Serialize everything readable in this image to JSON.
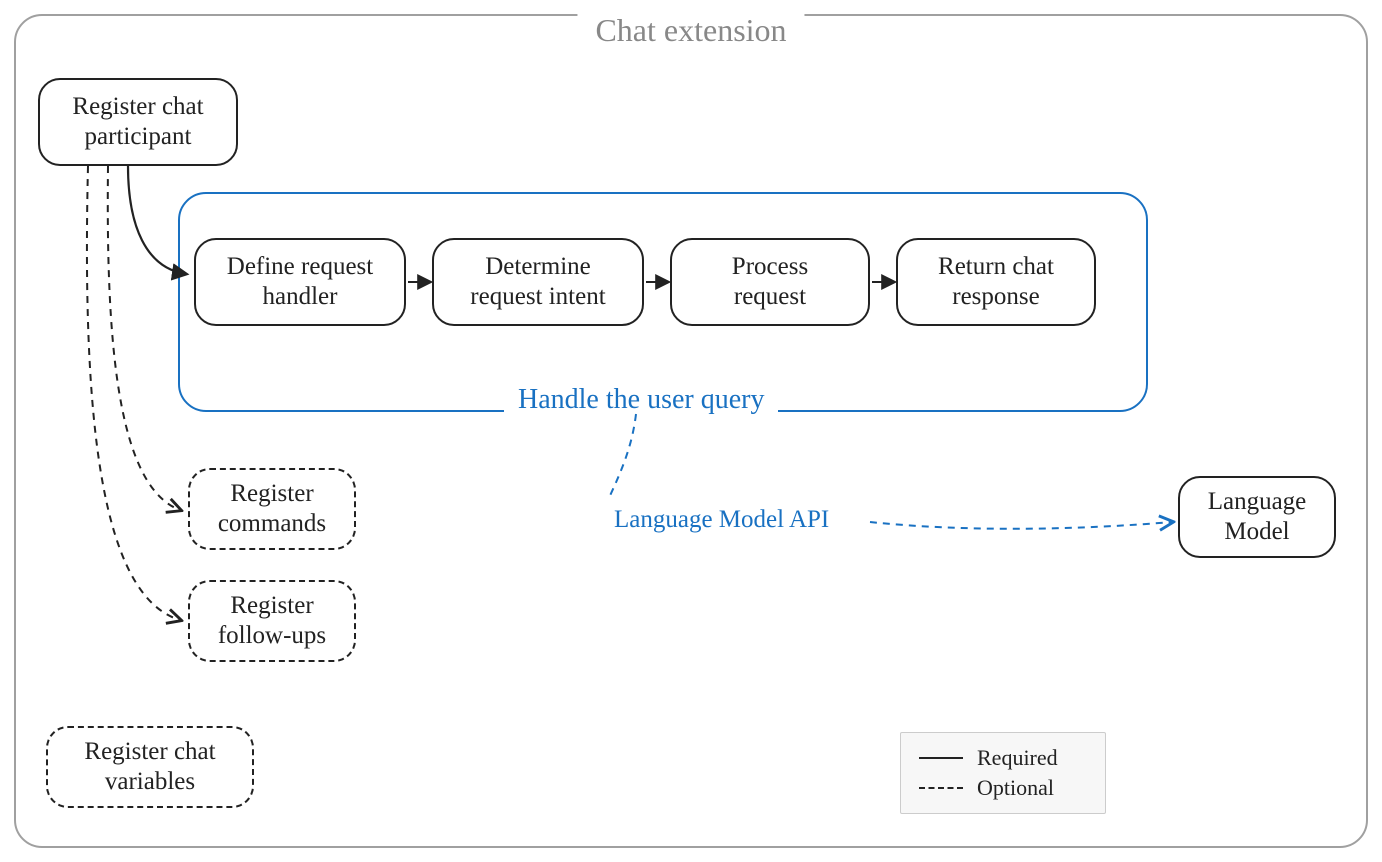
{
  "diagram": {
    "title": "Chat extension",
    "register_participant": "Register chat\nparticipant",
    "handle_group": {
      "label": "Handle the user query",
      "steps": {
        "define": "Define request\nhandler",
        "determine": "Determine\nrequest intent",
        "process": "Process\nrequest",
        "return": "Return chat\nresponse"
      }
    },
    "register_commands": "Register\ncommands",
    "register_followups": "Register\nfollow-ups",
    "register_variables": "Register chat\nvariables",
    "api_label": "Language Model API",
    "language_model": "Language\nModel",
    "legend": {
      "required": "Required",
      "optional": "Optional"
    }
  }
}
